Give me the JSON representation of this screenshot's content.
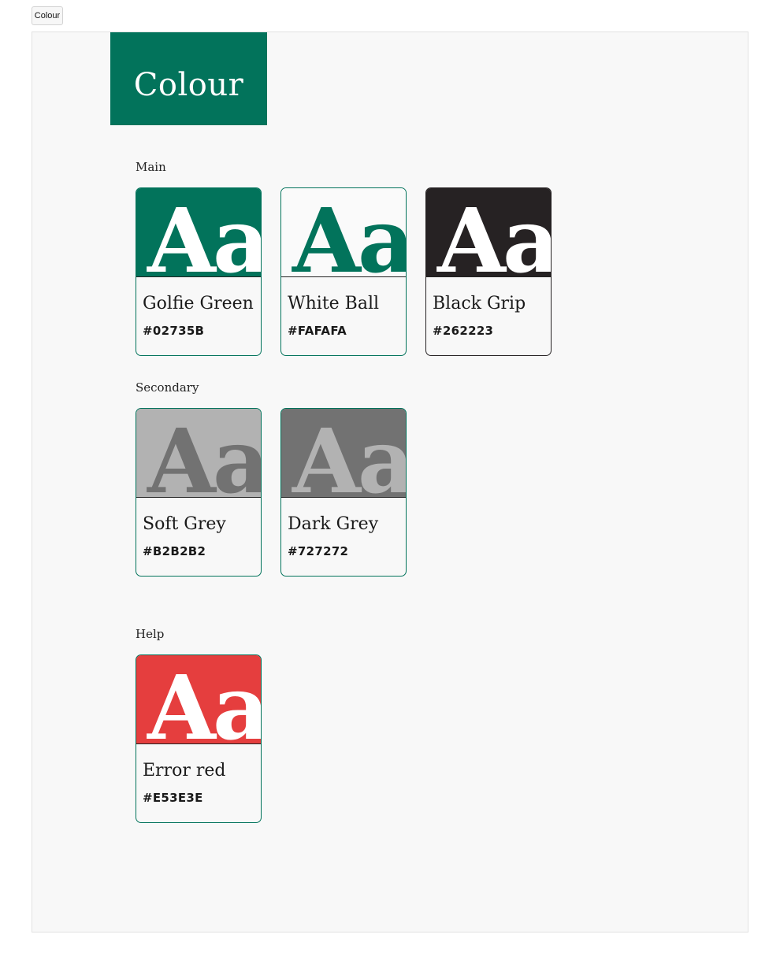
{
  "tab": {
    "label": "Colour"
  },
  "banner": {
    "title": "Colour"
  },
  "sections": {
    "main": {
      "label": "Main",
      "cards": [
        {
          "name": "Golfie Green",
          "hex": "#02735B",
          "glyph": "Aa",
          "swatch_color": "#02735B",
          "glyph_color": "#ffffff"
        },
        {
          "name": "White Ball",
          "hex": "#FAFAFA",
          "glyph": "Aa",
          "swatch_color": "#FAFAFA",
          "glyph_color": "#02735B"
        },
        {
          "name": "Black Grip",
          "hex": "#262223",
          "glyph": "Aa",
          "swatch_color": "#262223",
          "glyph_color": "#ffffff"
        }
      ]
    },
    "secondary": {
      "label": "Secondary",
      "cards": [
        {
          "name": "Soft Grey",
          "hex": "#B2B2B2",
          "glyph": "Aa",
          "swatch_color": "#B2B2B2",
          "glyph_color": "#727272"
        },
        {
          "name": "Dark Grey",
          "hex": "#727272",
          "glyph": "Aa",
          "swatch_color": "#727272",
          "glyph_color": "#B2B2B2"
        }
      ]
    },
    "help": {
      "label": "Help",
      "cards": [
        {
          "name": "Error red",
          "hex": "#E53E3E",
          "glyph": "Aa",
          "swatch_color": "#E53E3E",
          "glyph_color": "#ffffff"
        }
      ]
    }
  }
}
